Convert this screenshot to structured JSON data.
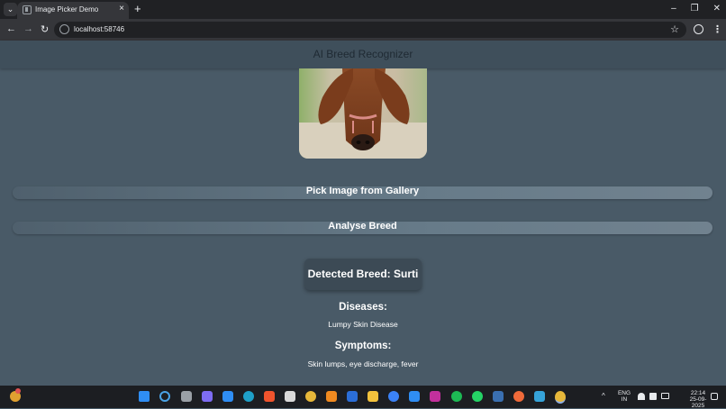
{
  "browser": {
    "tab_title": "Image Picker Demo",
    "tab_close": "×",
    "new_tab": "+",
    "url": "localhost:58746",
    "minimize": "–",
    "restore": "❐",
    "close": "✕",
    "back": "←",
    "forward": "→",
    "reload": "↻",
    "star": "☆",
    "menu": "⋮",
    "tab_menu": "⌄"
  },
  "app": {
    "title": "AI Breed Recognizer",
    "pick_button": "Pick Image from Gallery",
    "analyse_button": "Analyse Breed",
    "result_prefix": "Detected Breed: ",
    "breed": "Surti",
    "diseases_heading": "Diseases:",
    "diseases_text": "Lumpy Skin Disease",
    "symptoms_heading": "Symptoms:",
    "symptoms_text": "Skin lumps, eye discharge, fever"
  },
  "taskbar": {
    "language": "ENG",
    "region": "IN",
    "time": "22:14",
    "date": "25-09-2025",
    "chevron": "^"
  },
  "colors": {
    "background": "#495a67",
    "appbar": "#3f4f5b",
    "card": "#3c4a55",
    "button_gradient_end": "#71828f"
  }
}
